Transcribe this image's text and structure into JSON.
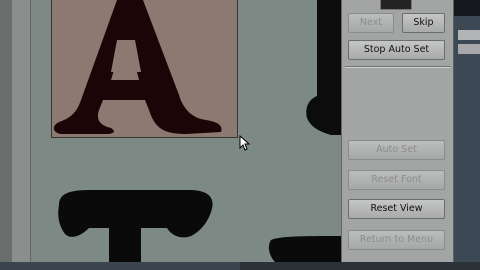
{
  "panel": {
    "buttons": {
      "next": "Next",
      "skip": "Skip",
      "stop_auto_set": "Stop Auto Set",
      "auto_set": "Auto Set",
      "reset_font": "Reset Font",
      "reset_view": "Reset View",
      "return_to_menu": "Return to Menu"
    }
  },
  "canvas": {
    "selected_glyph": "A",
    "next_glyph": "T"
  },
  "colors": {
    "canvas_bg": "#7c8984",
    "selection_bg": "#8c7a72",
    "glyph_fill": "#1a0606",
    "panel_bg": "#a3a4a4"
  }
}
